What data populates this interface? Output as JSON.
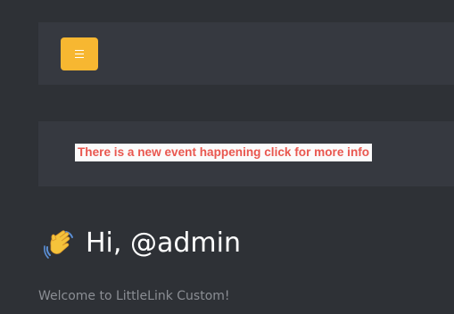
{
  "header": {
    "menu_icon": "hamburger-menu-icon",
    "accent_color": "#f7b731"
  },
  "notice": {
    "text": "There is a new event happening click for more info",
    "text_color": "#e9574f"
  },
  "greeting": {
    "emoji_icon": "waving-hand-icon",
    "text": "Hi, @admin"
  },
  "welcome": {
    "text": "Welcome to LittleLink Custom!"
  }
}
